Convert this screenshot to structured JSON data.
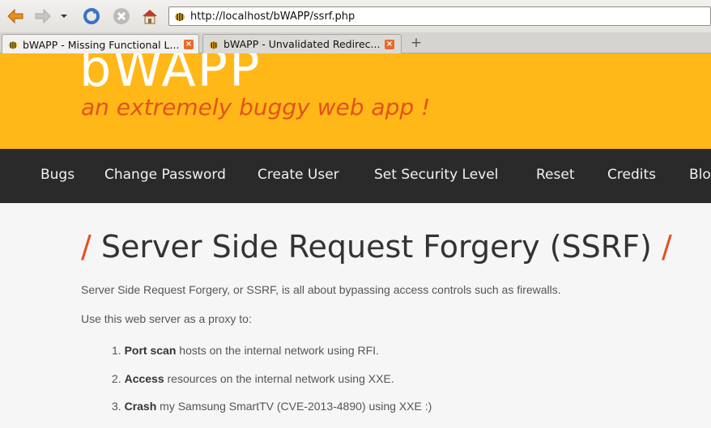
{
  "browser": {
    "url": "http://localhost/bWAPP/ssrf.php",
    "tabs": [
      {
        "label": "bWAPP - Missing Functional L..."
      },
      {
        "label": "bWAPP - Unvalidated Redirec..."
      }
    ]
  },
  "header": {
    "logo": "bWAPP",
    "tagline": "an extremely buggy web app !"
  },
  "menu": [
    "Bugs",
    "Change Password",
    "Create User",
    "Set Security Level",
    "Reset",
    "Credits",
    "Blo"
  ],
  "main": {
    "title": "Server Side Request Forgery (SSRF)",
    "slash": "/",
    "intro": "Server Side Request Forgery, or SSRF, is all about bypassing access controls such as firewalls.",
    "proxy_text": "Use this web server as a proxy to:",
    "items": [
      {
        "num": "1.",
        "bold": "Port scan",
        "rest": " hosts on the internal network using RFI."
      },
      {
        "num": "2.",
        "bold": "Access",
        "rest": " resources on the internal network using XXE."
      },
      {
        "num": "3.",
        "bold": "Crash",
        "rest": " my Samsung SmartTV (CVE-2013-4890) using XXE :)"
      }
    ]
  },
  "colors": {
    "header_bg": "#ffb818",
    "accent": "#e4511d",
    "menu_bg": "#2a2a2a"
  }
}
